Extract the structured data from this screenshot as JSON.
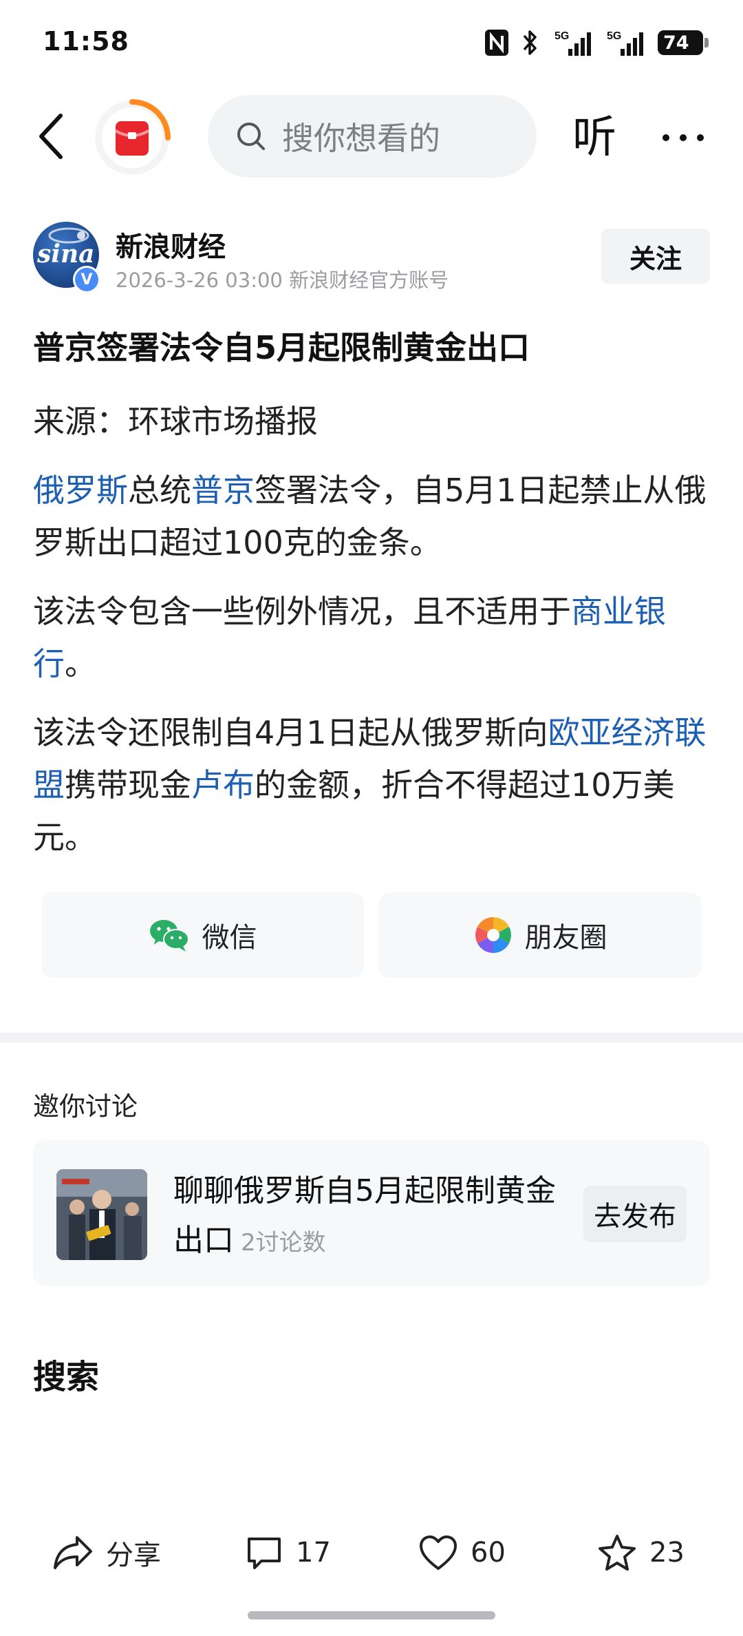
{
  "status_bar": {
    "time": "11:58",
    "battery": "74",
    "signal_1_label": "5G",
    "signal_2_label": "5G"
  },
  "top_nav": {
    "search_placeholder": "搜你想看的",
    "listen_label": "听"
  },
  "author": {
    "name": "新浪财经",
    "avatar_text": "sina",
    "verified_mark": "V",
    "meta": "2026-3-26  03:00  新浪财经官方账号",
    "follow_label": "关注"
  },
  "article": {
    "title": "普京签署法令自5月起限制黄金出口",
    "source": "来源：环球市场播报",
    "p1": {
      "link1": "俄罗斯",
      "t1": "总统",
      "link2": "普京",
      "t2": "签署法令，自5月1日起禁止从俄罗斯出口超过100克的金条。"
    },
    "p2": {
      "t1": "该法令包含一些例外情况，且不适用于",
      "link1": "商业银行",
      "t2": "。"
    },
    "p3": {
      "t1": "该法令还限制自4月1日起从俄罗斯向",
      "link1": "欧亚经济联盟",
      "t2": "携带现金",
      "link2": "卢布",
      "t3": "的金额，折合不得超过10万美元。"
    }
  },
  "share": {
    "wechat_label": "微信",
    "moments_label": "朋友圈"
  },
  "discussion": {
    "section_title": "邀你讨论",
    "topic": "聊聊俄罗斯自5月起限制黄金出口",
    "count": "2讨论数",
    "publish_label": "去发布"
  },
  "search_heading": "搜索",
  "bottom_bar": {
    "share_label": "分享",
    "comments": "17",
    "likes": "60",
    "favorites": "23"
  },
  "colors": {
    "link": "#1d5fb3",
    "search_bg": "#f2f3f5",
    "wechat_green": "#2aae67"
  }
}
